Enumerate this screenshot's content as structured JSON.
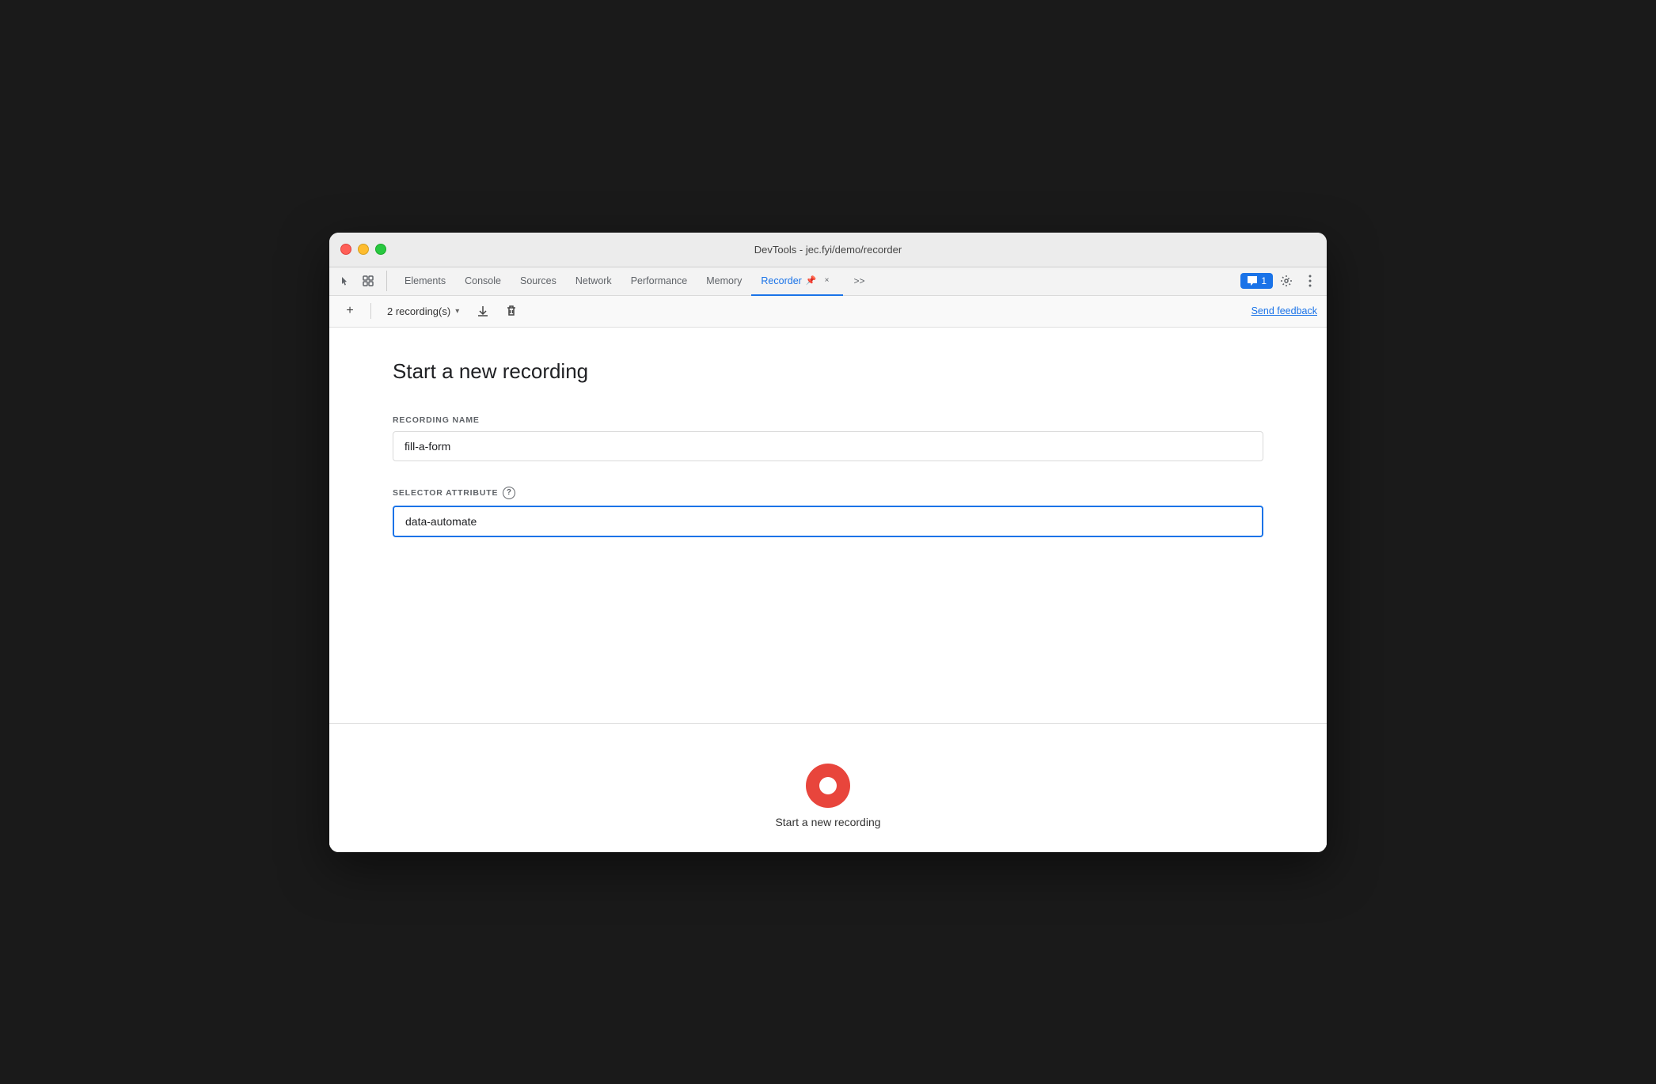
{
  "window": {
    "title": "DevTools - jec.fyi/demo/recorder"
  },
  "tabs": {
    "items": [
      {
        "id": "elements",
        "label": "Elements",
        "active": false
      },
      {
        "id": "console",
        "label": "Console",
        "active": false
      },
      {
        "id": "sources",
        "label": "Sources",
        "active": false
      },
      {
        "id": "network",
        "label": "Network",
        "active": false
      },
      {
        "id": "performance",
        "label": "Performance",
        "active": false
      },
      {
        "id": "memory",
        "label": "Memory",
        "active": false
      },
      {
        "id": "recorder",
        "label": "Recorder",
        "active": true
      }
    ],
    "more_label": ">>",
    "chat_count": "1",
    "close_label": "×"
  },
  "toolbar": {
    "add_label": "+",
    "recording_count": "2 recording(s)",
    "send_feedback": "Send feedback"
  },
  "main": {
    "page_title": "Start a new recording",
    "recording_name_label": "RECORDING NAME",
    "recording_name_value": "fill-a-form",
    "selector_attribute_label": "SELECTOR ATTRIBUTE",
    "selector_attribute_value": "data-automate",
    "help_icon_label": "?",
    "record_button_label": "Start a new recording"
  }
}
